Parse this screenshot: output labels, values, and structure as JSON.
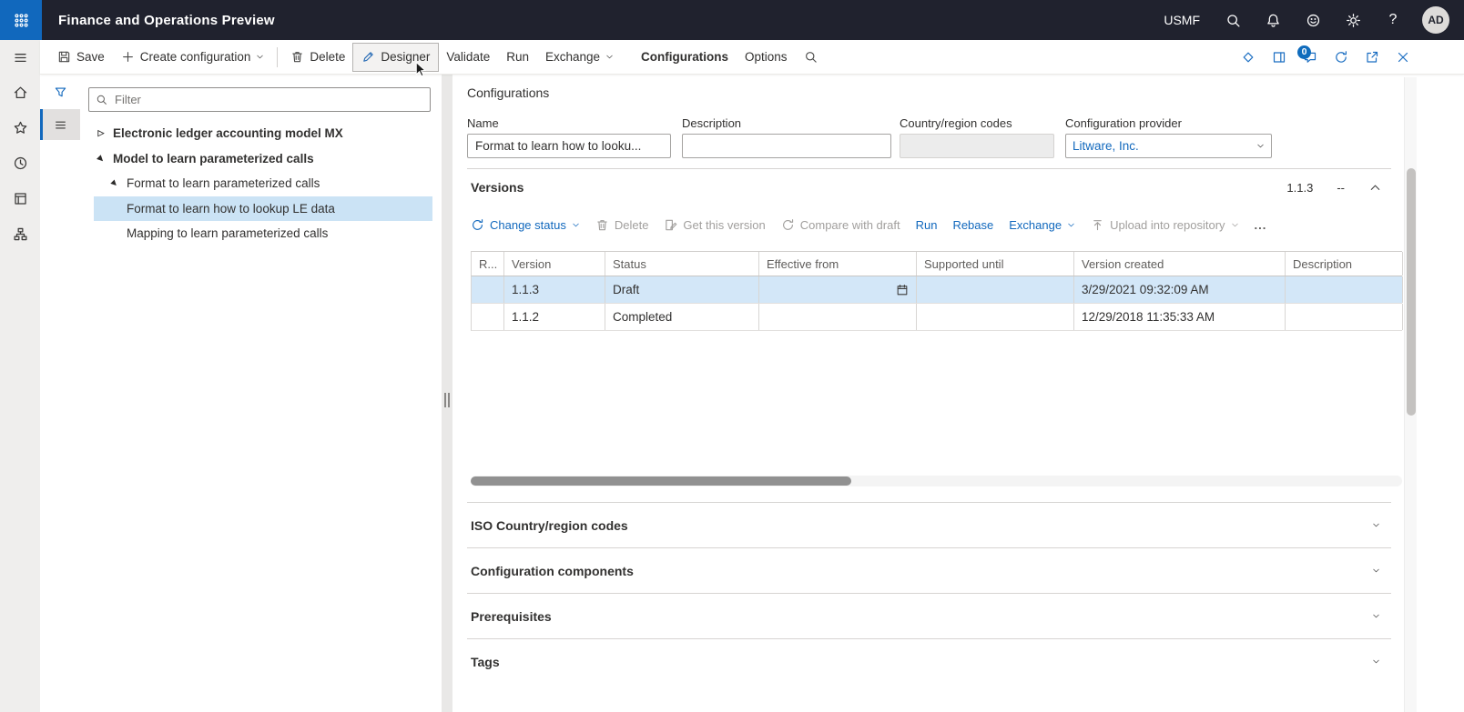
{
  "topbar": {
    "app_title": "Finance and Operations Preview",
    "company_badge": "USMF",
    "avatar_initials": "AD"
  },
  "action_bar": {
    "left_items": [
      {
        "id": "save",
        "label": "Save",
        "icon": "save"
      },
      {
        "id": "create-configuration",
        "label": "Create configuration",
        "icon": "plus",
        "chevron": true,
        "separator_after": true
      },
      {
        "id": "delete",
        "label": "Delete",
        "icon": "trash"
      },
      {
        "id": "designer",
        "label": "Designer",
        "icon": "designer",
        "hovered": true
      },
      {
        "id": "validate",
        "label": "Validate"
      },
      {
        "id": "run",
        "label": "Run"
      },
      {
        "id": "exchange",
        "label": "Exchange",
        "chevron": true
      },
      {
        "id": "configurations",
        "label": "Configurations",
        "active": true
      },
      {
        "id": "options",
        "label": "Options"
      },
      {
        "id": "search",
        "label": "",
        "icon": "search"
      }
    ],
    "right_items": [
      {
        "id": "power-apps",
        "icon": "diamond"
      },
      {
        "id": "task-pane",
        "icon": "side-pane"
      },
      {
        "id": "messages",
        "icon": "message",
        "badge": "0"
      },
      {
        "id": "refresh",
        "icon": "refresh"
      },
      {
        "id": "open-in-new-window",
        "icon": "open-new"
      },
      {
        "id": "close",
        "icon": "close"
      }
    ]
  },
  "left_nav": {
    "items": [
      {
        "id": "menu",
        "icon": "hamburger"
      },
      {
        "id": "home",
        "icon": "home"
      },
      {
        "id": "favorites",
        "icon": "star"
      },
      {
        "id": "recent",
        "icon": "clock"
      },
      {
        "id": "workspaces",
        "icon": "forms"
      },
      {
        "id": "modules",
        "icon": "hierarchy"
      }
    ]
  },
  "filter_pane": {
    "filter_placeholder": "Filter",
    "tools": [
      {
        "id": "filter",
        "icon": "funnel"
      },
      {
        "id": "view-list",
        "icon": "hamburger",
        "selected": true
      }
    ]
  },
  "tree": {
    "glyphs": {
      "collapsed": "▷",
      "expanded": "▶"
    },
    "items": [
      {
        "label": "Electronic ledger accounting model MX",
        "level": 0,
        "state": "collapsed",
        "bold": true
      },
      {
        "label": "Model to learn parameterized calls",
        "level": 0,
        "state": "expanded",
        "bold": true
      },
      {
        "label": "Format to learn parameterized calls",
        "level": 1,
        "state": "expanded",
        "bold": false
      },
      {
        "label": "Format to learn how to lookup LE data",
        "level": 2,
        "state": "leaf",
        "selected": true
      },
      {
        "label": "Mapping to learn parameterized calls",
        "level": 2,
        "state": "leaf"
      }
    ]
  },
  "main": {
    "page_title": "Configurations",
    "fields": [
      {
        "id": "name",
        "label": "Name",
        "value": "Format to learn how to looku...",
        "type": "text"
      },
      {
        "id": "description",
        "label": "Description",
        "value": "",
        "type": "text"
      },
      {
        "id": "country-region-codes",
        "label": "Country/region codes",
        "value": "",
        "type": "text",
        "disabled": true
      },
      {
        "id": "configuration-provider",
        "label": "Configuration provider",
        "value": "Litware, Inc.",
        "type": "combo"
      }
    ],
    "versions": {
      "title": "Versions",
      "current_version": "1.1.3",
      "draft_indicator": "--",
      "toolbar": [
        {
          "id": "change-status",
          "label": "Change status",
          "icon": "sync",
          "chevron": true,
          "enabled": true
        },
        {
          "id": "delete-version",
          "label": "Delete",
          "icon": "trash",
          "enabled": false
        },
        {
          "id": "get-this-version",
          "label": "Get this version",
          "icon": "get-version",
          "enabled": false
        },
        {
          "id": "compare-with-draft",
          "label": "Compare with draft",
          "icon": "sync",
          "enabled": false
        },
        {
          "id": "run-version",
          "label": "Run",
          "enabled": true
        },
        {
          "id": "rebase",
          "label": "Rebase",
          "enabled": true
        },
        {
          "id": "exchange-version",
          "label": "Exchange",
          "chevron": true,
          "enabled": true
        },
        {
          "id": "upload-into-repository",
          "label": "Upload into repository",
          "icon": "upload",
          "chevron": true,
          "enabled": false
        },
        {
          "id": "more-commands",
          "label": "...",
          "enabled": true,
          "more": true
        }
      ],
      "grid": {
        "columns": [
          "R...",
          "Version",
          "Status",
          "Effective from",
          "Supported until",
          "Version created",
          "Description"
        ],
        "rows": [
          {
            "cells": [
              "",
              "1.1.3",
              "Draft",
              "",
              "",
              "3/29/2021 09:32:09 AM",
              ""
            ],
            "selected": true,
            "datepicker_cell": 3
          },
          {
            "cells": [
              "",
              "1.1.2",
              "Completed",
              "",
              "",
              "12/29/2018 11:35:33 AM",
              ""
            ]
          }
        ]
      }
    },
    "collapsed_sections": [
      {
        "label": "ISO Country/region codes"
      },
      {
        "label": "Configuration components"
      },
      {
        "label": "Prerequisites"
      },
      {
        "label": "Tags"
      }
    ]
  }
}
